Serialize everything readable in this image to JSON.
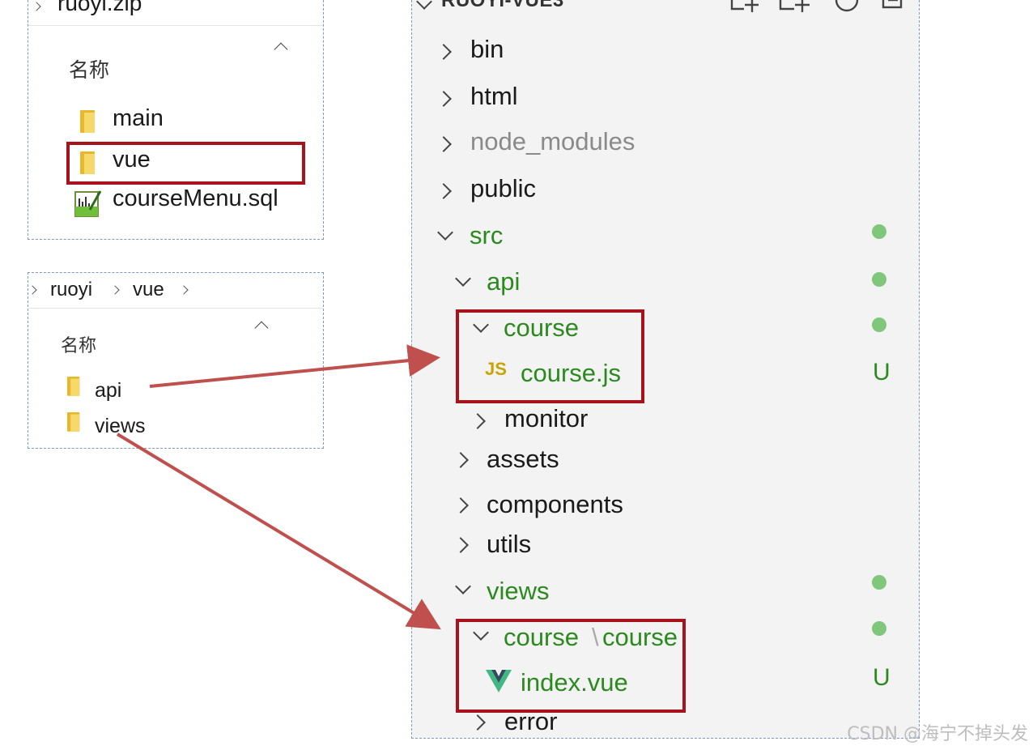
{
  "zip_panel": {
    "breadcrumb": "ruoyi.zip",
    "column_header": "名称",
    "items": [
      {
        "label": "main",
        "type": "folder"
      },
      {
        "label": "vue",
        "type": "folder",
        "highlighted": true
      },
      {
        "label": "courseMenu.sql",
        "type": "sql-file"
      }
    ]
  },
  "vue_panel": {
    "breadcrumb": [
      "ruoyi",
      "vue"
    ],
    "column_header": "名称",
    "items": [
      {
        "label": "api",
        "type": "folder"
      },
      {
        "label": "views",
        "type": "folder"
      }
    ]
  },
  "vscode_explorer": {
    "root_label": "RUOYI-VUE3",
    "tree": [
      {
        "label": "bin",
        "state": "collapsed"
      },
      {
        "label": "html",
        "state": "collapsed"
      },
      {
        "label": "node_modules",
        "state": "collapsed",
        "dimmed": true
      },
      {
        "label": "public",
        "state": "collapsed"
      },
      {
        "label": "src",
        "state": "expanded",
        "status": "modified-dot"
      },
      {
        "label": "api",
        "state": "expanded",
        "status": "modified-dot"
      },
      {
        "label": "course",
        "state": "expanded",
        "status": "modified-dot",
        "highlighted": true
      },
      {
        "label": "course.js",
        "type": "js-file",
        "file_icon": "JS",
        "status": "U",
        "highlighted": true
      },
      {
        "label": "monitor",
        "state": "collapsed"
      },
      {
        "label": "assets",
        "state": "collapsed"
      },
      {
        "label": "components",
        "state": "collapsed"
      },
      {
        "label": "utils",
        "state": "collapsed"
      },
      {
        "label": "views",
        "state": "expanded",
        "status": "modified-dot"
      },
      {
        "label": "course",
        "label_sep": "\\",
        "label_tail": "course",
        "state": "expanded",
        "status": "modified-dot",
        "highlighted": true
      },
      {
        "label": "index.vue",
        "type": "vue-file",
        "status": "U",
        "highlighted": true
      },
      {
        "label": "error",
        "state": "collapsed"
      }
    ]
  },
  "colors": {
    "highlight_box": "#a8121b",
    "arrow": "#c0504d",
    "git_added": "#2b8a1e",
    "modified_dot": "#7fc77a"
  },
  "watermark": "CSDN @海宁不掉头发"
}
